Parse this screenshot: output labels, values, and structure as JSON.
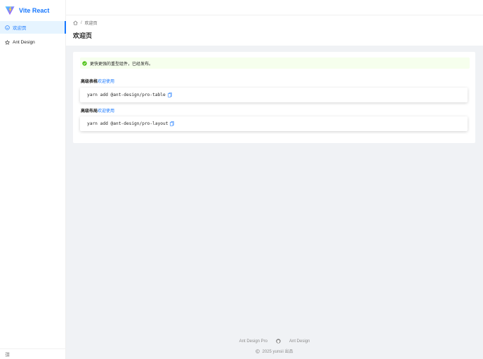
{
  "app": {
    "name": "Vite React",
    "brand_color": "#1677ff"
  },
  "sidebar": {
    "items": [
      {
        "label": "欢迎页",
        "icon": "smile-icon",
        "active": true
      },
      {
        "label": "Ant Design",
        "icon": "star-icon",
        "active": false
      }
    ],
    "collapse_icon": "menu-fold-icon"
  },
  "breadcrumb": {
    "home_icon": "home-icon",
    "current": "欢迎页",
    "separator": "/"
  },
  "page": {
    "title": "欢迎页"
  },
  "alert": {
    "text": "更快更强的重型组件，已经发布。",
    "type": "success",
    "color": "#52c41a"
  },
  "sections": [
    {
      "label": "高级表格",
      "link": "欢迎使用",
      "command": "yarn add @ant-design/pro-table"
    },
    {
      "label": "高级布局",
      "link": "欢迎使用",
      "command": "yarn add @ant-design/pro-layout"
    }
  ],
  "footer": {
    "links": [
      "Ant Design Pro",
      "Ant Design"
    ],
    "copyright": "2025 yunsii 出品"
  }
}
